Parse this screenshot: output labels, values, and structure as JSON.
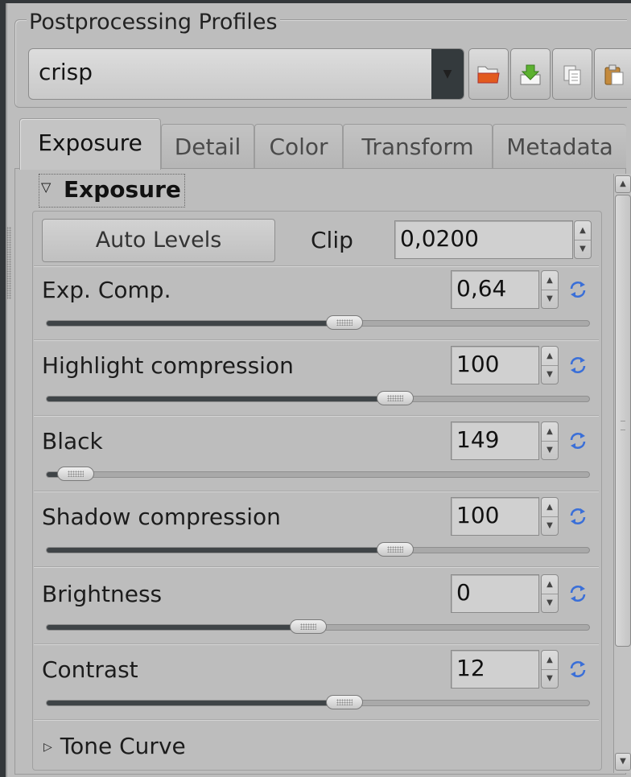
{
  "profiles": {
    "title": "Postprocessing Profiles",
    "selected": "crisp"
  },
  "tabs": [
    {
      "label": "Exposure",
      "active": true
    },
    {
      "label": "Detail"
    },
    {
      "label": "Color"
    },
    {
      "label": "Transform"
    },
    {
      "label": "Metadata"
    }
  ],
  "exposure": {
    "header": "Exposure",
    "auto_levels": "Auto Levels",
    "clip_label": "Clip",
    "clip_value": "0,0200",
    "controls": [
      {
        "label": "Exp. Comp.",
        "value": "0,64",
        "slider_fraction": 0.55
      },
      {
        "label": "Highlight compression",
        "value": "100",
        "slider_fraction": 0.65
      },
      {
        "label": "Black",
        "value": "149",
        "slider_fraction": 0.02
      },
      {
        "label": "Shadow compression",
        "value": "100",
        "slider_fraction": 0.65
      },
      {
        "label": "Brightness",
        "value": "0",
        "slider_fraction": 0.48
      },
      {
        "label": "Contrast",
        "value": "12",
        "slider_fraction": 0.55
      }
    ]
  },
  "tone_curve": "Tone Curve",
  "colors": {
    "accent_icon": "#3a6fd8",
    "slider_fill": "#3f4447"
  }
}
